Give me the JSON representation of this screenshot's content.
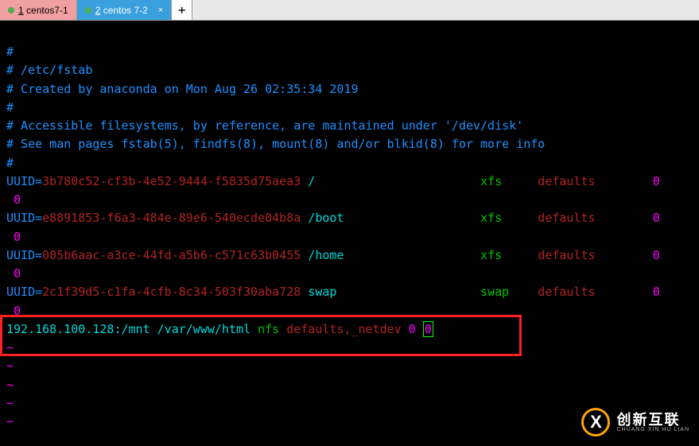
{
  "tabs": [
    {
      "num": "1",
      "label": "centos7-1",
      "active": false
    },
    {
      "num": "2",
      "label": "centos 7-2",
      "active": true
    }
  ],
  "tab_add": "+",
  "tab_close": "×",
  "comments": {
    "l1": "#",
    "l2": "# /etc/fstab",
    "l3": "# Created by anaconda on Mon Aug 26 02:35:34 2019",
    "l4": "#",
    "l5": "# Accessible filesystems, by reference, are maintained under '/dev/disk'",
    "l6": "# See man pages fstab(5), findfs(8), mount(8) and/or blkid(8) for more info",
    "l7": "#"
  },
  "entries": [
    {
      "uuid": "3b780c52-cf3b-4e52-9444-f5835d75aea3",
      "mount": "/",
      "fstype": "xfs",
      "opts": "defaults",
      "d1": "0",
      "d2": "0"
    },
    {
      "uuid": "e8891853-f6a3-484e-89e6-540ecde04b8a",
      "mount": "/boot",
      "fstype": "xfs",
      "opts": "defaults",
      "d1": "0",
      "d2": "0"
    },
    {
      "uuid": "005b6aac-a3ce-44fd-a5b6-c571c63b0455",
      "mount": "/home",
      "fstype": "xfs",
      "opts": "defaults",
      "d1": "0",
      "d2": "0"
    },
    {
      "uuid": "2c1f39d5-c1fa-4cfb-8c34-503f30aba728",
      "mount": "swap",
      "fstype": "swap",
      "opts": "defaults",
      "d1": "0",
      "d2": "0"
    }
  ],
  "uuid_label": "UUID=",
  "nfs_line": {
    "ip": "192.168.100.128",
    "colon": ":",
    "remote": "/mnt",
    "local": "/var/www/html",
    "fstype": "nfs",
    "opts1": "defaults",
    "comma": ",",
    "opts2": "_netdev",
    "d1": "0",
    "d2": "0"
  },
  "tilde": "~",
  "watermark": {
    "main": "创新互联",
    "sub": "CHUANG XIN HU LIAN"
  }
}
